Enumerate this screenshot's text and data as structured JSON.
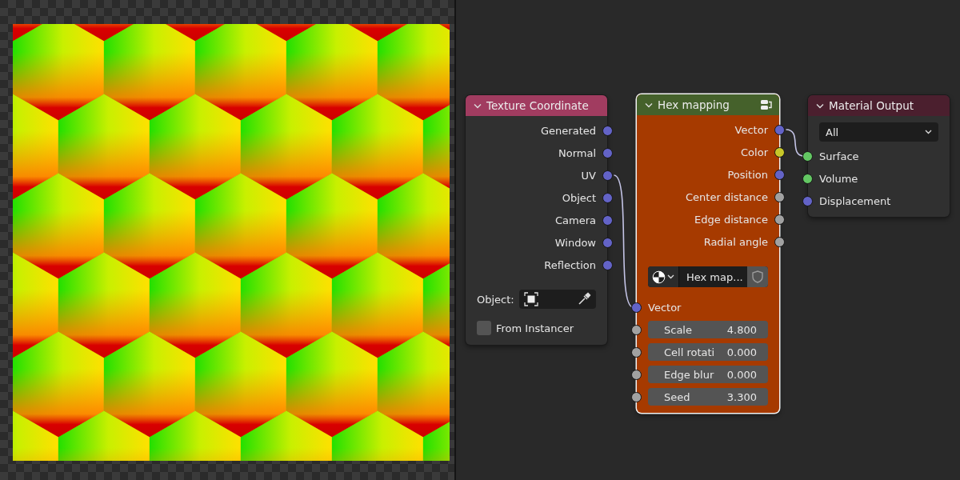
{
  "nodes": [
    {
      "kind": "texture",
      "title": "Texture Coordinate",
      "color": "#a13c60",
      "selected": false,
      "outputs": [
        {
          "label": "Generated",
          "color": "#6363c7"
        },
        {
          "label": "Normal",
          "color": "#6363c7"
        },
        {
          "label": "UV",
          "color": "#6363c7"
        },
        {
          "label": "Object",
          "color": "#6363c7"
        },
        {
          "label": "Camera",
          "color": "#6363c7"
        },
        {
          "label": "Window",
          "color": "#6363c7"
        },
        {
          "label": "Reflection",
          "color": "#6363c7"
        }
      ],
      "object_field": {
        "label": "Object:"
      },
      "checkbox": {
        "label": "From Instancer",
        "checked": false
      }
    },
    {
      "kind": "group",
      "title": "Hex mapping",
      "color": "#45612b",
      "selected": true,
      "outputs": [
        {
          "label": "Vector",
          "color": "#6363c7"
        },
        {
          "label": "Color",
          "color": "#c7c729"
        },
        {
          "label": "Position",
          "color": "#6363c7"
        },
        {
          "label": "Center distance",
          "color": "#a1a1a1"
        },
        {
          "label": "Edge distance",
          "color": "#a1a1a1"
        },
        {
          "label": "Radial angle",
          "color": "#a1a1a1"
        }
      ],
      "datablock": {
        "value": "Hex map..."
      },
      "inputs": [
        {
          "kind": "socket",
          "label": "Vector",
          "color": "#6363c7"
        },
        {
          "kind": "field",
          "label": "Scale",
          "value": "4.800",
          "color": "#a1a1a1"
        },
        {
          "kind": "field",
          "label": "Cell rotati",
          "value": "0.000",
          "color": "#a1a1a1"
        },
        {
          "kind": "field",
          "label": "Edge blur",
          "value": "0.000",
          "color": "#a1a1a1"
        },
        {
          "kind": "field",
          "label": "Seed",
          "value": "3.300",
          "color": "#a1a1a1"
        }
      ]
    },
    {
      "kind": "output",
      "title": "Material Output",
      "color": "#4b1f2e",
      "selected": false,
      "dropdown": {
        "value": "All"
      },
      "inputs": [
        {
          "kind": "socket",
          "label": "Surface",
          "color": "#63c763"
        },
        {
          "kind": "socket",
          "label": "Volume",
          "color": "#63c763"
        },
        {
          "kind": "socket",
          "label": "Displacement",
          "color": "#6363c7"
        }
      ]
    }
  ]
}
